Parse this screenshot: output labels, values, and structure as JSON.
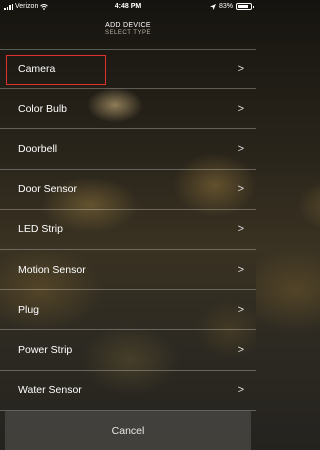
{
  "status_bar": {
    "carrier": "Verizon",
    "time": "4:48 PM",
    "battery_percent": "83%",
    "battery_level": 0.83
  },
  "header": {
    "title": "ADD DEVICE",
    "subtitle": "SELECT TYPE"
  },
  "devices": [
    {
      "label": "Camera"
    },
    {
      "label": "Color Bulb"
    },
    {
      "label": "Doorbell"
    },
    {
      "label": "Door Sensor"
    },
    {
      "label": "LED Strip"
    },
    {
      "label": "Motion Sensor"
    },
    {
      "label": "Plug"
    },
    {
      "label": "Power Strip"
    },
    {
      "label": "Water Sensor"
    }
  ],
  "chevron_glyph": ">",
  "cancel_label": "Cancel",
  "icons": {
    "signal": "signal-bars-icon",
    "wifi": "wifi-icon",
    "location": "location-arrow-icon",
    "battery": "battery-icon",
    "chevron": "chevron-right-icon"
  },
  "colors": {
    "highlight": "#e0312f"
  }
}
